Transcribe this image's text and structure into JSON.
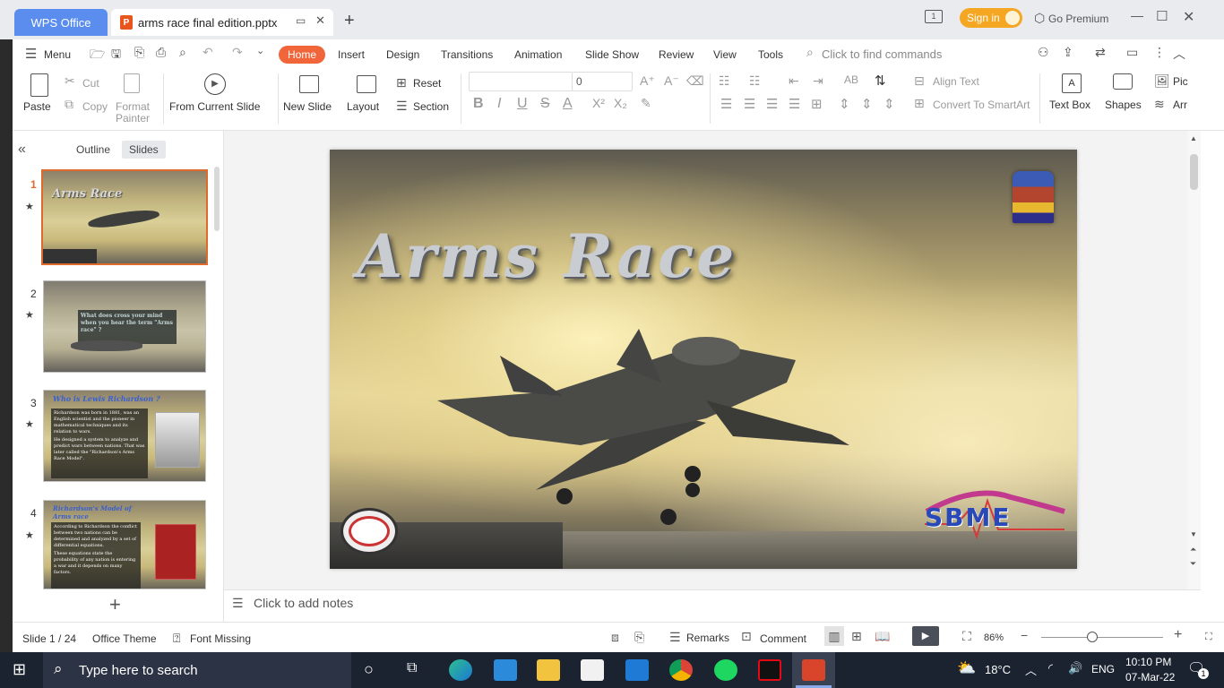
{
  "titlebar": {
    "wps_tab": "WPS Office",
    "doc_tab": "arms race final edition.pptx",
    "sign_in": "Sign in",
    "go_premium": "Go Premium"
  },
  "ribbon": {
    "menu": "Menu",
    "tabs": [
      "Home",
      "Insert",
      "Design",
      "Transitions",
      "Animation",
      "Slide Show",
      "Review",
      "View",
      "Tools"
    ],
    "active_tab": "Home",
    "search_placeholder": "Click to find commands"
  },
  "toolbar": {
    "paste": "Paste",
    "cut": "Cut",
    "copy": "Copy",
    "format_painter_1": "Format",
    "format_painter_2": "Painter",
    "from_current_slide": "From Current Slide",
    "new_slide": "New Slide",
    "layout": "Layout",
    "reset": "Reset",
    "section": "Section",
    "font_name": "",
    "font_size": "0",
    "align_text": "Align Text",
    "convert_smartart": "Convert To SmartArt",
    "text_box": "Text Box",
    "shapes": "Shapes",
    "picture": "Pic",
    "arrange": "Arr"
  },
  "panel": {
    "outline_tab": "Outline",
    "slides_tab": "Slides",
    "slides": [
      {
        "num": "1",
        "title": "Arms Race"
      },
      {
        "num": "2",
        "title": "What does cross your mind when you hear the term \"Arms race\" ?"
      },
      {
        "num": "3",
        "title": "Who is Lewis Richardson ?",
        "lines": [
          "Richardson was born in 1881, was an English scientist and the pioneer in mathematical techniques and its relation to wars.",
          "He designed a system to analyze and predict wars between nations. That was later called the \"Richardson's Arms Race Model\"."
        ]
      },
      {
        "num": "4",
        "title": "Richardson's Model of Arms race",
        "lines": [
          "According to Richardson the conflict between two nations can be determined and analyzed by a set of differential equations.",
          "These equations state the probability of any nation is entering a war and it depends on many factors."
        ]
      }
    ]
  },
  "slide": {
    "title": "Arms Race",
    "logo_right": "SBME"
  },
  "notes": {
    "placeholder": "Click to add notes"
  },
  "status": {
    "slide_counter": "Slide 1 / 24",
    "theme": "Office Theme",
    "font_missing": "Font Missing",
    "remarks": "Remarks",
    "comment": "Comment",
    "zoom": "86%"
  },
  "taskbar": {
    "search_placeholder": "Type here to search",
    "weather": "18°C",
    "language": "ENG",
    "time": "10:10 PM",
    "date": "07-Mar-22",
    "notifications": "1"
  }
}
